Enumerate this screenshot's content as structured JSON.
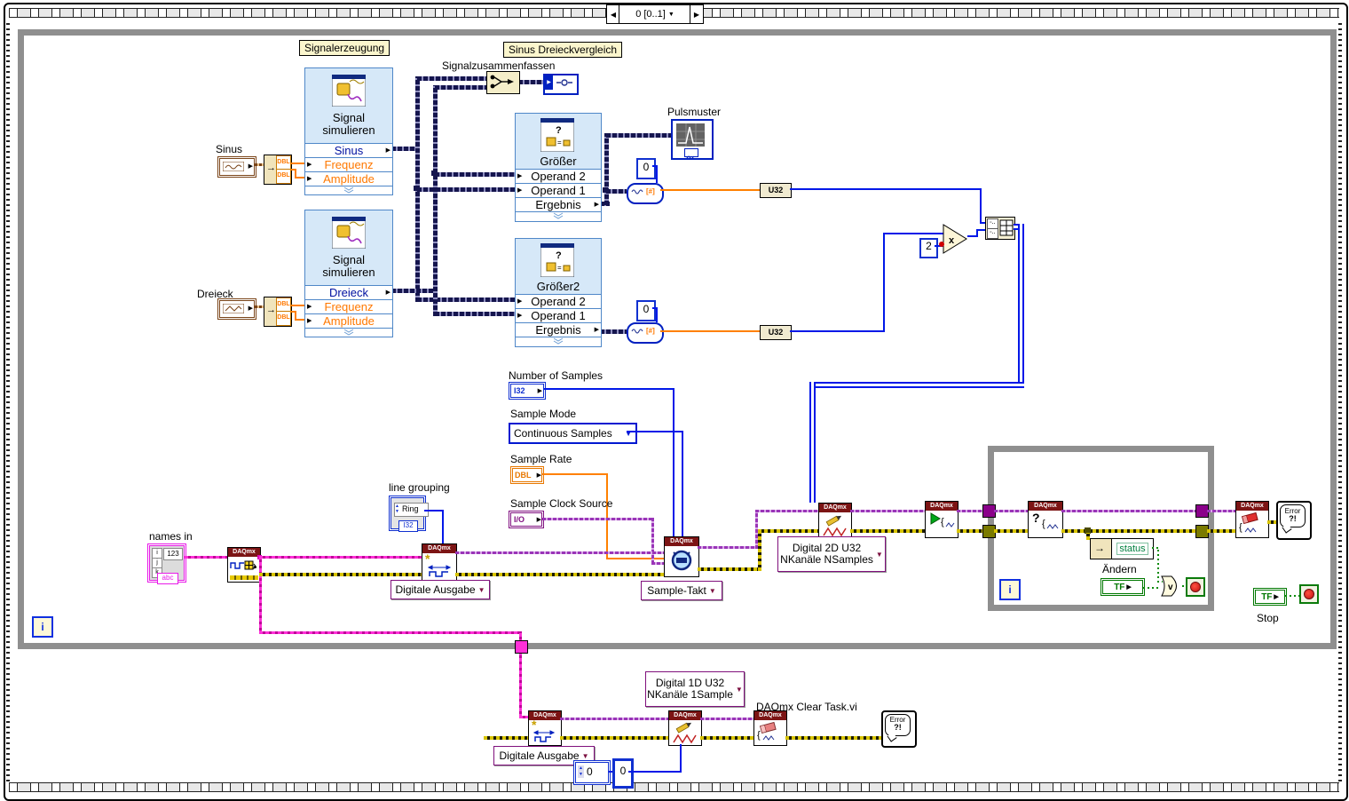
{
  "frame": {
    "selector": "0 [0..1]"
  },
  "labels": {
    "signalerzeugung": "Signalerzeugung",
    "sinus_dreieckvergleich": "Sinus Dreieckvergleich",
    "signalzusammenfassen": "Signalzusammenfassen",
    "pulsmuster": "Pulsmuster",
    "names_in": "names in",
    "line_grouping": "line grouping",
    "number_of_samples": "Number of Samples",
    "sample_mode": "Sample Mode",
    "sample_rate": "Sample Rate",
    "sample_clock_source": "Sample Clock Source",
    "aendern": "Ändern",
    "stop": "Stop",
    "daqmx_clear_task": "DAQmx Clear Task.vi",
    "sinus": "Sinus",
    "dreieck": "Dreieck"
  },
  "signal1": {
    "line1": "Signal",
    "line2": "simulieren",
    "out": "Sinus",
    "in1": "Frequenz",
    "in2": "Amplitude"
  },
  "signal2": {
    "line1": "Signal",
    "line2": "simulieren",
    "out": "Dreieck",
    "in1": "Frequenz",
    "in2": "Amplitude"
  },
  "groesser1": {
    "title": "Größer",
    "op2": "Operand 2",
    "op1": "Operand 1",
    "res": "Ergebnis"
  },
  "groesser2": {
    "title": "Größer2",
    "op2": "Operand 2",
    "op1": "Operand 1",
    "res": "Ergebnis"
  },
  "daqmx": {
    "header": "DAQmx",
    "create_selector": "Digitale Ausgabe",
    "timing_selector": "Sample-Takt",
    "write2d_line1": "Digital 2D U32",
    "write2d_line2": "NKanäle NSamples",
    "write1d_line1": "Digital 1D U32",
    "write1d_line2": "NKanäle 1Sample",
    "create2_selector": "Digitale Ausgabe"
  },
  "controls": {
    "number_of_samples_type": "I32",
    "sample_mode_value": "Continuous Samples",
    "sample_rate_type": "DBL",
    "sample_clock_type": "I/O",
    "ring_text": "Ring",
    "ring_tag": "I32",
    "names_digits": "123",
    "names_i": "i",
    "names_j": "j",
    "names_k": "k",
    "names_tag": "abc",
    "tf": "TF",
    "status": "status"
  },
  "consts": {
    "zero1": "0",
    "zero2": "0",
    "two": "2",
    "u32_1": "U32",
    "u32_2": "U32",
    "zero_ctrl": "0",
    "zero_const": "0",
    "dbl": "DBL"
  },
  "misc": {
    "iteration": "i",
    "error_line1": "Error",
    "error_line2": "?!",
    "multiply_glyph": "x",
    "or_glyph": "v"
  }
}
